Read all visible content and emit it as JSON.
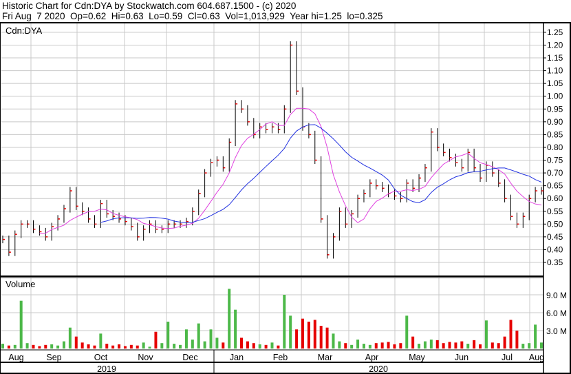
{
  "header": {
    "title": "Historic Chart for Cdn:DYA by Stockwatch.com 604.687.1500 - (c) 2020",
    "summary": "Fri Aug  7 2020  Op=0.62  Hi=0.63  Lo=0.59  Cl=0.63  Vol=1,013,929  Year hi=1.25  lo=0.325"
  },
  "colors": {
    "up": "#4cb848",
    "down": "#e60000",
    "ma_short": "#e040e0",
    "ma_long": "#2030e0",
    "grid": "#c8c8c8"
  },
  "chart_data": {
    "type": "line",
    "symbol_label": "Cdn:DYA",
    "volume_label": "Volume",
    "price_ticks": [
      0.35,
      0.4,
      0.45,
      0.5,
      0.55,
      0.6,
      0.65,
      0.7,
      0.75,
      0.8,
      0.85,
      0.9,
      0.95,
      1.0,
      1.05,
      1.1,
      1.15,
      1.2,
      1.25
    ],
    "price_ylim": [
      0.32,
      1.285
    ],
    "volume_ticks": [
      {
        "value": 3,
        "label": "3.0 M"
      },
      {
        "value": 6,
        "label": "6.0 M"
      },
      {
        "value": 9,
        "label": "9.0 M"
      }
    ],
    "volume_ylim": [
      0,
      11.5
    ],
    "months": [
      "Aug",
      "Sep",
      "Oct",
      "Nov",
      "Dec",
      "Jan",
      "Feb",
      "Mar",
      "Apr",
      "May",
      "Jun",
      "Jul",
      "Aug"
    ],
    "years": [
      "2019",
      "2020"
    ],
    "close": [
      0.44,
      0.39,
      0.46,
      0.5,
      0.5,
      0.48,
      0.47,
      0.45,
      0.49,
      0.52,
      0.56,
      0.63,
      0.57,
      0.55,
      0.52,
      0.5,
      0.58,
      0.54,
      0.53,
      0.52,
      0.51,
      0.49,
      0.45,
      0.48,
      0.5,
      0.48,
      0.48,
      0.5,
      0.5,
      0.5,
      0.51,
      0.55,
      0.62,
      0.7,
      0.74,
      0.75,
      0.72,
      0.82,
      0.97,
      0.95,
      0.9,
      0.85,
      0.88,
      0.87,
      0.88,
      0.87,
      0.95,
      1.2,
      1.02,
      0.88,
      0.85,
      0.75,
      0.52,
      0.38,
      0.45,
      0.55,
      0.5,
      0.54,
      0.6,
      0.62,
      0.66,
      0.65,
      0.64,
      0.62,
      0.61,
      0.6,
      0.66,
      0.64,
      0.68,
      0.72,
      0.86,
      0.8,
      0.78,
      0.76,
      0.74,
      0.72,
      0.78,
      0.72,
      0.68,
      0.73,
      0.7,
      0.66,
      0.6,
      0.53,
      0.5,
      0.53,
      0.6,
      0.63,
      0.63
    ],
    "bar_range": 0.03,
    "volume_millions": [
      0.8,
      0.5,
      0.6,
      8.0,
      0.9,
      0.6,
      0.4,
      0.6,
      0.7,
      0.5,
      1.2,
      3.5,
      2.0,
      1.0,
      0.7,
      0.5,
      2.5,
      0.8,
      0.5,
      0.7,
      0.4,
      0.6,
      0.5,
      1.0,
      0.3,
      2.8,
      0.9,
      4.5,
      0.8,
      0.6,
      3.2,
      1.5,
      4.2,
      1.2,
      3.2,
      1.8,
      1.0,
      10.0,
      6.5,
      1.8,
      1.2,
      0.9,
      0.7,
      0.6,
      1.0,
      0.5,
      9.0,
      5.5,
      3.2,
      5.0,
      4.5,
      4.8,
      3.8,
      3.5,
      2.5,
      1.2,
      0.9,
      0.6,
      1.5,
      0.8,
      0.6,
      0.9,
      1.0,
      1.1,
      0.7,
      0.9,
      5.5,
      2.0,
      0.8,
      1.2,
      1.5,
      1.4,
      0.9,
      1.1,
      1.0,
      1.2,
      0.8,
      1.4,
      0.7,
      4.7,
      1.0,
      0.9,
      2.0,
      4.8,
      3.0,
      0.8,
      0.9,
      4.0,
      1.0
    ],
    "ma_windows": [
      7,
      17
    ]
  }
}
